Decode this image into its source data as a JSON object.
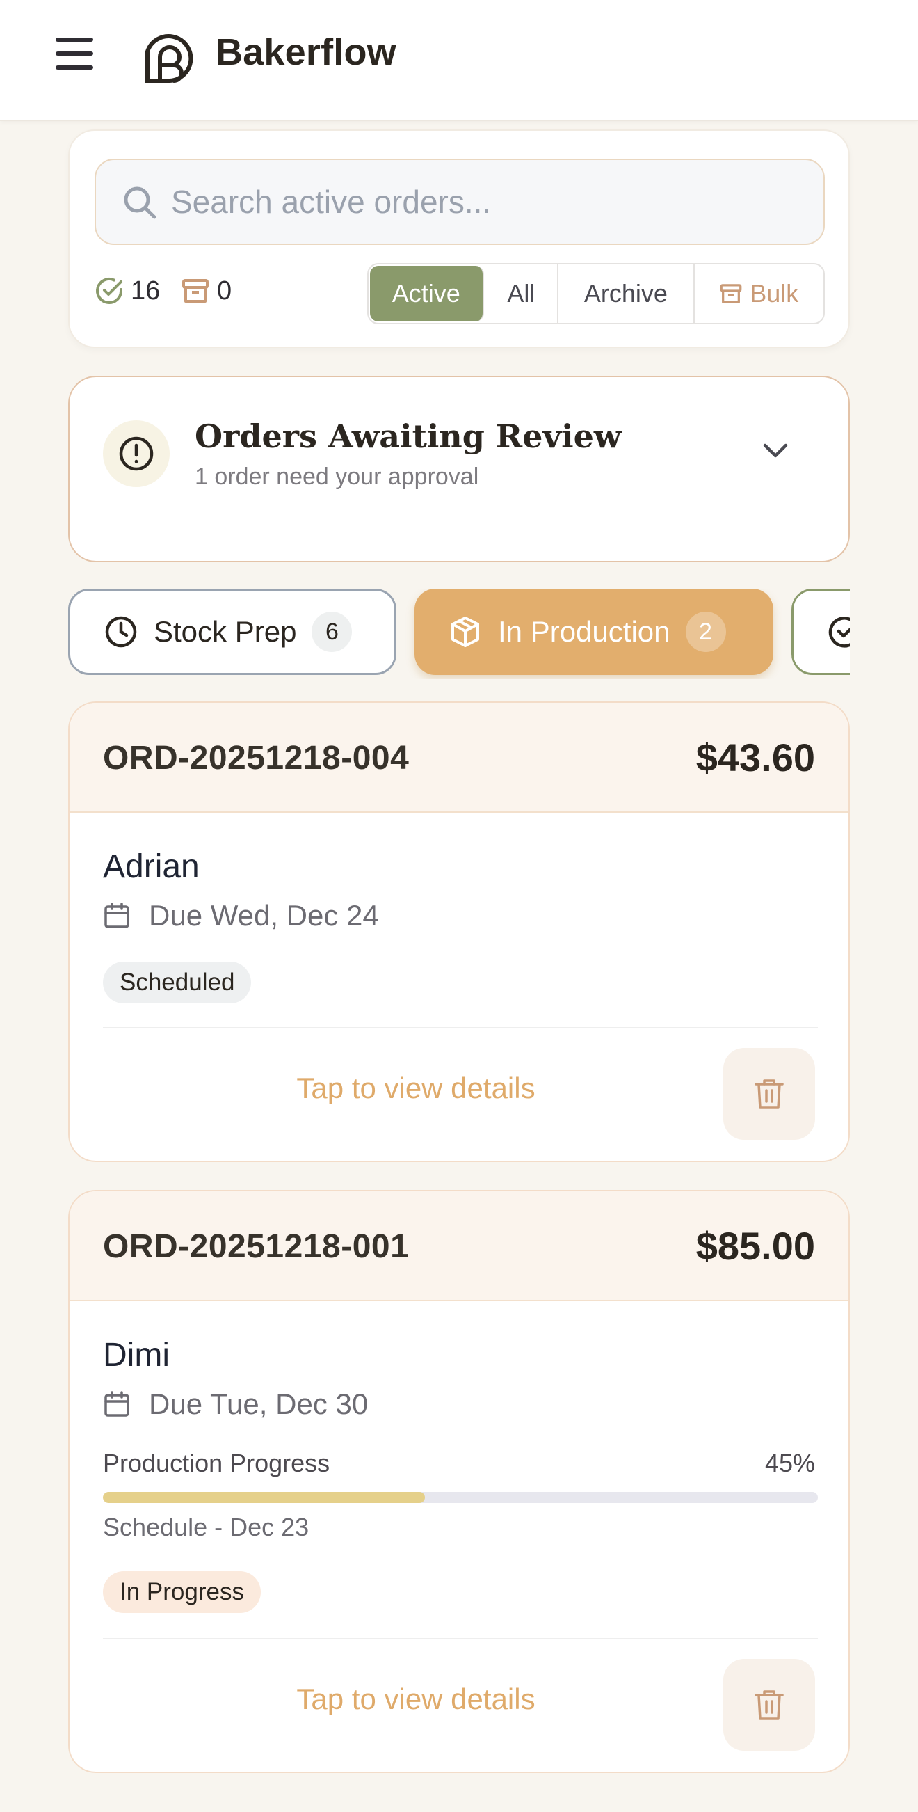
{
  "header": {
    "app_name": "Bakerflow",
    "menu_icon": "hamburger-icon",
    "logo_icon": "bakerflow-logo-icon"
  },
  "search": {
    "placeholder": "Search active orders...",
    "value": ""
  },
  "stats": {
    "completed_count": "16",
    "archived_count": "0"
  },
  "filters": {
    "active": "Active",
    "all": "All",
    "archive": "Archive",
    "bulk": "Bulk",
    "selected": "Active"
  },
  "review": {
    "title": "Orders Awaiting Review",
    "subtitle": "1 order need your approval"
  },
  "tabs": [
    {
      "label": "Stock Prep",
      "count": "6",
      "icon": "clock-icon"
    },
    {
      "label": "In Production",
      "count": "2",
      "icon": "box-icon",
      "selected": true
    },
    {
      "label": "",
      "icon": "check-circle-icon"
    }
  ],
  "orders": [
    {
      "id": "ORD-20251218-004",
      "price": "$43.60",
      "customer": "Adrian",
      "due": "Due Wed, Dec 24",
      "status": "Scheduled",
      "action": "Tap to view details"
    },
    {
      "id": "ORD-20251218-001",
      "price": "$85.00",
      "customer": "Dimi",
      "due": "Due Tue, Dec 30",
      "progress_label": "Production Progress",
      "progress_text": "45%",
      "progress": 0.45,
      "schedule": "Schedule - Dec 23",
      "status": "In Progress",
      "action": "Tap to view details"
    }
  ],
  "colors": {
    "accent_olive": "#8a9a6b",
    "accent_caramel": "#e2ae6d",
    "progress_fill": "#e5d08a",
    "background": "#f8f5ef"
  }
}
